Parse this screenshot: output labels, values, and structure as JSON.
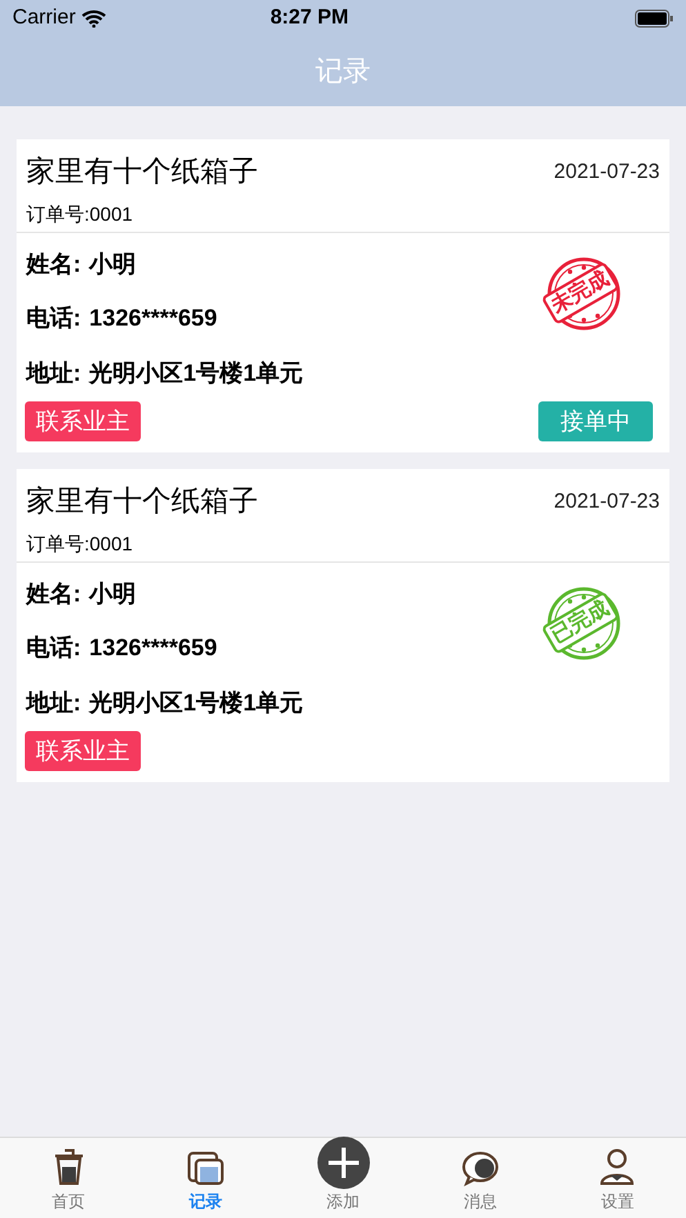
{
  "status_bar": {
    "carrier": "Carrier",
    "time": "8:27 PM"
  },
  "nav": {
    "title": "记录"
  },
  "orders": [
    {
      "title": "家里有十个纸箱子",
      "date": "2021-07-23",
      "order_no": "订单号:0001",
      "fields": [
        {
          "label": "姓名:",
          "value": "小明"
        },
        {
          "label": "电话:",
          "value": "1326****659"
        },
        {
          "label": "地址:",
          "value": "光明小区1号楼1单元"
        }
      ],
      "stamp": {
        "text": "未完成",
        "color": "#e8213a"
      },
      "contact_button": "联系业主",
      "status_button": "接单中"
    },
    {
      "title": "家里有十个纸箱子",
      "date": "2021-07-23",
      "order_no": "订单号:0001",
      "fields": [
        {
          "label": "姓名:",
          "value": "小明"
        },
        {
          "label": "电话:",
          "value": "1326****659"
        },
        {
          "label": "地址:",
          "value": "光明小区1号楼1单元"
        }
      ],
      "stamp": {
        "text": "已完成",
        "color": "#5bb82e"
      },
      "contact_button": "联系业主"
    }
  ],
  "tabs": [
    {
      "label": "首页",
      "kind": "home",
      "selected": false
    },
    {
      "label": "记录",
      "kind": "records",
      "selected": true
    },
    {
      "label": "添加",
      "kind": "add",
      "selected": false
    },
    {
      "label": "消息",
      "kind": "messages",
      "selected": false
    },
    {
      "label": "设置",
      "kind": "settings",
      "selected": false
    }
  ]
}
